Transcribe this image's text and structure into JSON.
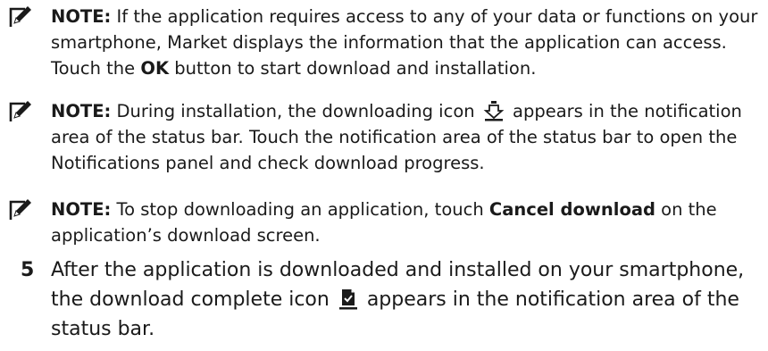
{
  "notes": [
    {
      "icon": "pencil-note-icon",
      "label": "NOTE:",
      "text_1": " If the application requires access to any of your data or functions on your smartphone, Market displays the information that the application can access. Touch the ",
      "bold_1": "OK",
      "text_2": " button to start download and installation."
    },
    {
      "icon": "pencil-note-icon",
      "label": "NOTE:",
      "text_1": " During installation, the downloading icon ",
      "inline_icon": "download-arrow-icon",
      "text_2": " appears in the notification area of the status bar. Touch the notification area of the status bar to open the Notifications panel and check download progress."
    },
    {
      "icon": "pencil-note-icon",
      "label": "NOTE:",
      "text_1": " To stop downloading an application, touch ",
      "bold_1": "Cancel download",
      "text_2": " on the application’s download screen."
    }
  ],
  "step": {
    "number": "5",
    "text_1": "After the application is downloaded and installed on your smartphone, the download complete icon ",
    "inline_icon": "download-complete-icon",
    "text_2": " appears in the notification area of the status bar."
  }
}
